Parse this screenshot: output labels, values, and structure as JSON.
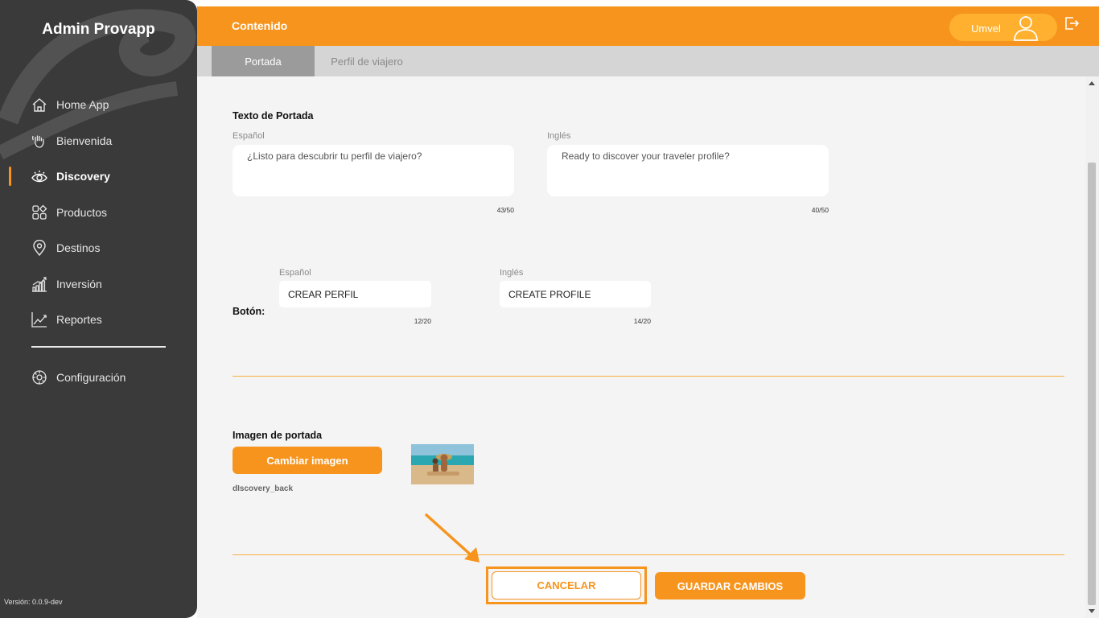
{
  "app": {
    "title": "Admin Provapp",
    "version": "Versión: 0.0.9-dev"
  },
  "sidebar": {
    "items": [
      {
        "label": "Home App",
        "icon": "home-icon",
        "active": false
      },
      {
        "label": "Bienvenida",
        "icon": "wave-hand-icon",
        "active": false
      },
      {
        "label": "Discovery",
        "icon": "eye-icon",
        "active": true
      },
      {
        "label": "Productos",
        "icon": "grid-shapes-icon",
        "active": false
      },
      {
        "label": "Destinos",
        "icon": "location-pin-icon",
        "active": false
      },
      {
        "label": "Inversión",
        "icon": "bar-chart-icon",
        "active": false
      },
      {
        "label": "Reportes",
        "icon": "line-chart-icon",
        "active": false
      }
    ],
    "config": {
      "label": "Configuración",
      "icon": "gear-icon"
    }
  },
  "header": {
    "title": "Contenido",
    "user_name": "Umvel"
  },
  "tabs": [
    {
      "label": "Portada",
      "active": true
    },
    {
      "label": "Perfil de viajero",
      "active": false
    }
  ],
  "cover_text": {
    "title": "Texto de Portada",
    "spanish": {
      "label": "Español",
      "value": "¿Listo para descubrir tu perfil de viajero?",
      "counter": "43/50"
    },
    "english": {
      "label": "Inglés",
      "value": "Ready to discover your traveler profile?",
      "counter": "40/50"
    }
  },
  "button_text": {
    "label": "Botón:",
    "spanish": {
      "label": "Español",
      "value": "CREAR PERFIL",
      "counter": "12/20"
    },
    "english": {
      "label": "Inglés",
      "value": "CREATE PROFILE",
      "counter": "14/20"
    }
  },
  "cover_image": {
    "title": "Imagen de portada",
    "change_label": "Cambiar imagen",
    "filename": "dIscovery_back"
  },
  "actions": {
    "cancel_label": "CANCELAR",
    "save_label": "GUARDAR CAMBIOS"
  },
  "colors": {
    "accent": "#f7941d",
    "sidebar": "#3a3a3a",
    "content_bg": "#f4f4f4",
    "tab_active": "#9b9b9b"
  }
}
